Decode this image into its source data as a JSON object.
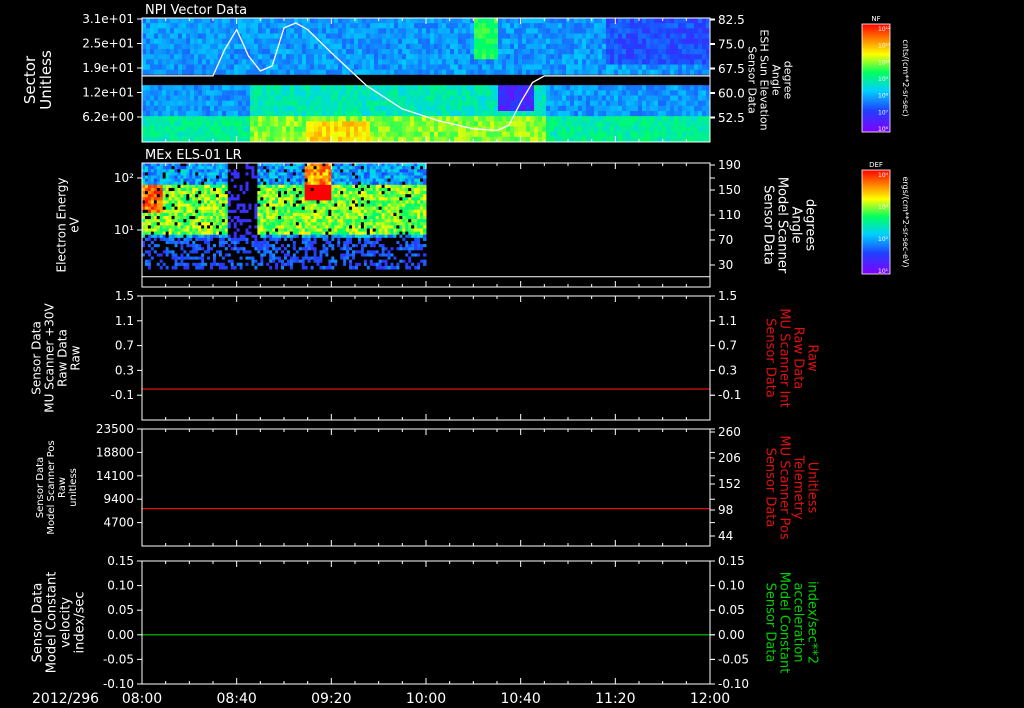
{
  "date_label": "2012/296",
  "time_ticks": [
    "08:00",
    "08:40",
    "09:20",
    "10:00",
    "10:40",
    "11:20",
    "12:00"
  ],
  "colors": {
    "red": "#e01010",
    "green": "#00d000",
    "white": "#ffffff"
  },
  "chart_data": [
    {
      "type": "heatmap",
      "title": "NPI Vector Data",
      "ylabel": [
        "Sector",
        "Unitless"
      ],
      "yticks": [
        "3.1e+01",
        "2.5e+01",
        "1.9e+01",
        "1.2e+01",
        "6.2e+00"
      ],
      "ytick_values": [
        31,
        25,
        19,
        12,
        6.2
      ],
      "ylim": [
        1,
        31
      ],
      "right_axis": {
        "label": [
          "Sensor Data",
          "ESH Sun Elevation",
          "Angle",
          "degree"
        ],
        "ticks": [
          "82.5",
          "75.0",
          "67.5",
          "60.0",
          "52.5"
        ],
        "tick_values": [
          82.5,
          75.0,
          67.5,
          60.0,
          52.5
        ],
        "ylim": [
          45,
          82.5
        ],
        "line_color": "#ffffff",
        "series": {
          "name": "ESH Sun Elevation",
          "x_minutes": [
            0,
            30,
            35,
            40,
            45,
            50,
            55,
            60,
            65,
            70,
            80,
            95,
            110,
            125,
            140,
            150,
            155,
            160,
            165,
            170,
            180,
            240
          ],
          "y": [
            65,
            65,
            73,
            79,
            71,
            66.5,
            68,
            79.5,
            81,
            79,
            72,
            62,
            55,
            51.5,
            49,
            48.5,
            50,
            57,
            63,
            65,
            65,
            65
          ]
        }
      },
      "colorbar": {
        "label": "NF",
        "units": "cnts/(cm**2-sr-sec)",
        "ticks": [
          "10¹²",
          "10¹¹",
          "10¹⁰",
          "10⁹",
          "10⁸",
          "10⁷",
          "10⁶"
        ]
      }
    },
    {
      "type": "heatmap",
      "title": "MEx ELS-01 LR",
      "ylabel": [
        "Electron Energy",
        "eV"
      ],
      "yticks": [
        "10²",
        "10¹"
      ],
      "ytick_values": [
        100,
        10
      ],
      "ylim": [
        1,
        200
      ],
      "data_end_minutes": 120,
      "right_axis": {
        "label": [
          "Sensor Data",
          "Model Scanner",
          "Angle",
          "degrees"
        ],
        "ticks": [
          "190",
          "150",
          "110",
          "70",
          "30"
        ],
        "tick_values": [
          190,
          150,
          110,
          70,
          30
        ],
        "ylim": [
          0,
          190
        ],
        "line_value": 5
      },
      "colorbar": {
        "label": "DEF",
        "units": "ergs/(cm**2-sr-sec-eV)",
        "ticks": [
          "10⁴",
          "10³",
          "10²",
          "10¹"
        ]
      }
    },
    {
      "type": "line",
      "ylabel": [
        "Sensor Data",
        "MU Scanner +30V",
        "Raw Data",
        "Raw"
      ],
      "yticks": [
        "1.5",
        "1.1",
        "0.7",
        "0.3",
        "-0.1"
      ],
      "ytick_values": [
        1.5,
        1.1,
        0.7,
        0.3,
        -0.1
      ],
      "ylim": [
        -0.5,
        1.5
      ],
      "series": [
        {
          "value": 0.0,
          "color": "#e01010"
        }
      ],
      "right_axis": {
        "label": [
          "Sensor Data",
          "MU Scanner Int",
          "Raw Data",
          "Raw"
        ],
        "ticks": [
          "1.5",
          "1.1",
          "0.7",
          "0.3",
          "-0.1"
        ],
        "color": "#e01010"
      }
    },
    {
      "type": "line",
      "ylabel": [
        "Sensor Data",
        "Model Scanner Pos",
        "Raw",
        "unitless"
      ],
      "yticks": [
        "23500",
        "18800",
        "14100",
        "9400",
        "4700"
      ],
      "ytick_values": [
        23500,
        18800,
        14100,
        9400,
        4700
      ],
      "ylim": [
        0,
        23500
      ],
      "series": [
        {
          "value": 7500,
          "color": "#e01010"
        }
      ],
      "right_axis": {
        "label": [
          "Sensor Data",
          "MU Scanner Pos",
          "Telemetry",
          "Unitless"
        ],
        "ticks": [
          "260",
          "206",
          "152",
          "98",
          "44"
        ],
        "color": "#e01010"
      }
    },
    {
      "type": "line",
      "ylabel": [
        "Sensor Data",
        "Model Constant",
        "velocity",
        "index/sec"
      ],
      "yticks": [
        "0.15",
        "0.10",
        "0.05",
        "0.00",
        "-0.05",
        "-0.10"
      ],
      "ytick_values": [
        0.15,
        0.1,
        0.05,
        0.0,
        -0.05,
        -0.1
      ],
      "ylim": [
        -0.1,
        0.15
      ],
      "series": [
        {
          "value": 0.0,
          "color": "#00d000"
        }
      ],
      "right_axis": {
        "label": [
          "Sensor Data",
          "Model Constant",
          "acceleration",
          "index/sec**2"
        ],
        "ticks": [
          "0.15",
          "0.10",
          "0.05",
          "0.00",
          "-0.05",
          "-0.10"
        ],
        "color": "#00d000"
      }
    }
  ]
}
